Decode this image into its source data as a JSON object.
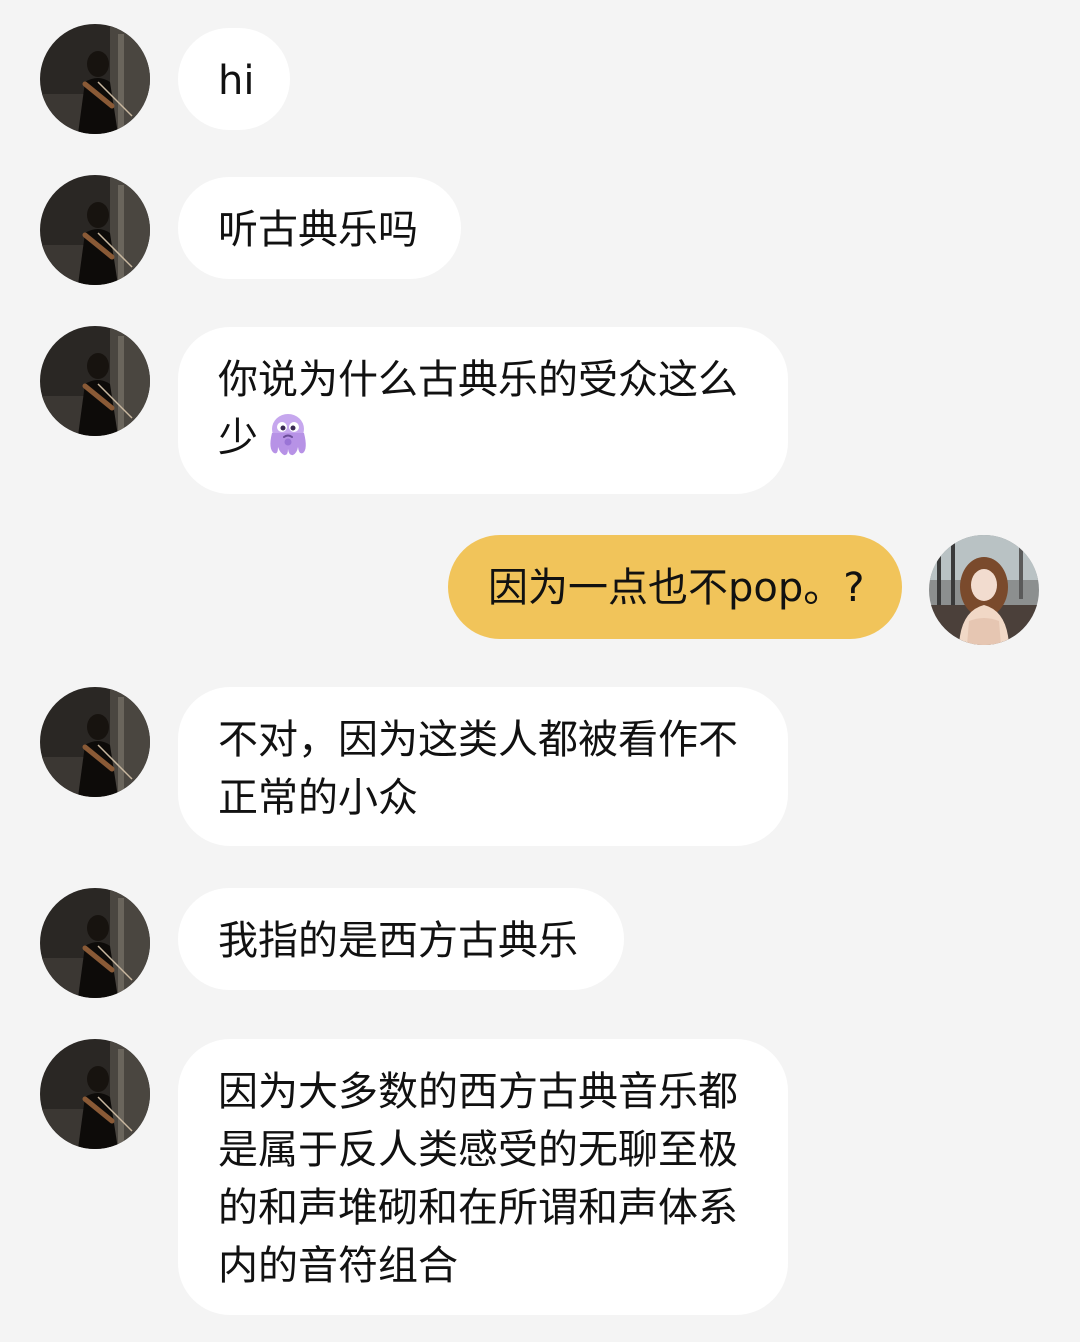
{
  "theme": {
    "background": "#f4f4f4",
    "incoming_bubble": "#ffffff",
    "outgoing_bubble": "#f1c45a",
    "text": "#111111"
  },
  "messages": [
    {
      "sender": "other",
      "text": "hi"
    },
    {
      "sender": "other",
      "text": "听古典乐吗"
    },
    {
      "sender": "other",
      "text": "你说为什么古典乐的受众这么少",
      "emoji": "octopus-emoji"
    },
    {
      "sender": "me",
      "text": "因为一点也不pop。?"
    },
    {
      "sender": "other",
      "text": "不对，因为这类人都被看作不正常的小众"
    },
    {
      "sender": "other",
      "text": "我指的是西方古典乐"
    },
    {
      "sender": "other",
      "text": "因为大多数的西方古典音乐都是属于反人类感受的无聊至极的和声堆砌和在所谓和声体系内的音符组合"
    }
  ]
}
